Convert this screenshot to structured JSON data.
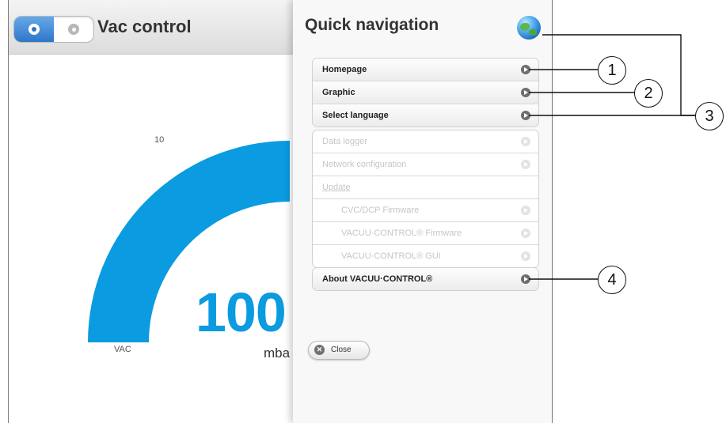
{
  "app": {
    "title": "Vac control",
    "toggle": {
      "on_icon": "circle-dot-icon",
      "off_icon": "circle-dot-icon"
    },
    "gauge": {
      "tick_label_top": "10",
      "value_display": "100",
      "unit": "mba",
      "vac_label": "VAC",
      "arc_color": "#0a9be0"
    }
  },
  "panel": {
    "title": "Quick navigation",
    "globe_icon": "globe-icon",
    "main_items": [
      {
        "label": "Homepage"
      },
      {
        "label": "Graphic"
      },
      {
        "label": "Select language"
      }
    ],
    "disabled_items": [
      {
        "label": "Data logger",
        "arrow": true
      },
      {
        "label": "Network configuration",
        "arrow": true
      },
      {
        "label": "Update",
        "arrow": false
      },
      {
        "label": "CVC/DCP Firmware",
        "arrow": true
      },
      {
        "label": "VACUU·CONTROL® Firmware",
        "arrow": true
      },
      {
        "label": "VACUU·CONTROL® GUI",
        "arrow": true
      }
    ],
    "about_item": {
      "label": "About VACUU·CONTROL®"
    },
    "close_button": {
      "label": "Close"
    }
  },
  "callouts": [
    "1",
    "2",
    "3",
    "4"
  ],
  "colors": {
    "accent": "#0a9be0",
    "toggle_active": "#2f76c9"
  }
}
